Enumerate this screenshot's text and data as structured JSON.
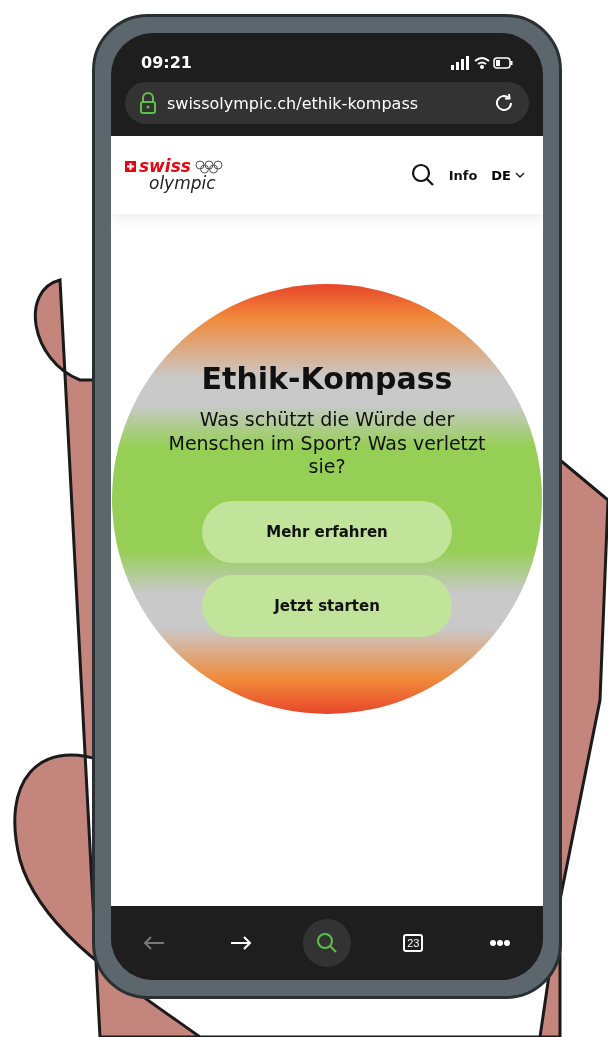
{
  "status_bar": {
    "time": "09:21"
  },
  "address_bar": {
    "url": "swissolympic.ch/ethik-kompass"
  },
  "header": {
    "logo_top": "swiss",
    "logo_bottom": "olympic",
    "nav": [
      "Info"
    ],
    "language": "DE"
  },
  "hero": {
    "title": "Ethik-Kompass",
    "subtitle": "Was schützt die Würde der Menschen im Sport? Was verletzt sie?",
    "buttons": [
      "Mehr erfahren",
      "Jetzt starten"
    ]
  },
  "toolbar": [
    {
      "kind": "back",
      "disabled": true,
      "selected": false
    },
    {
      "kind": "forward",
      "disabled": false,
      "selected": false
    },
    {
      "kind": "search",
      "disabled": false,
      "selected": true
    },
    {
      "kind": "tabs",
      "label": "23",
      "disabled": false,
      "selected": false
    },
    {
      "kind": "more",
      "disabled": false,
      "selected": false
    }
  ]
}
